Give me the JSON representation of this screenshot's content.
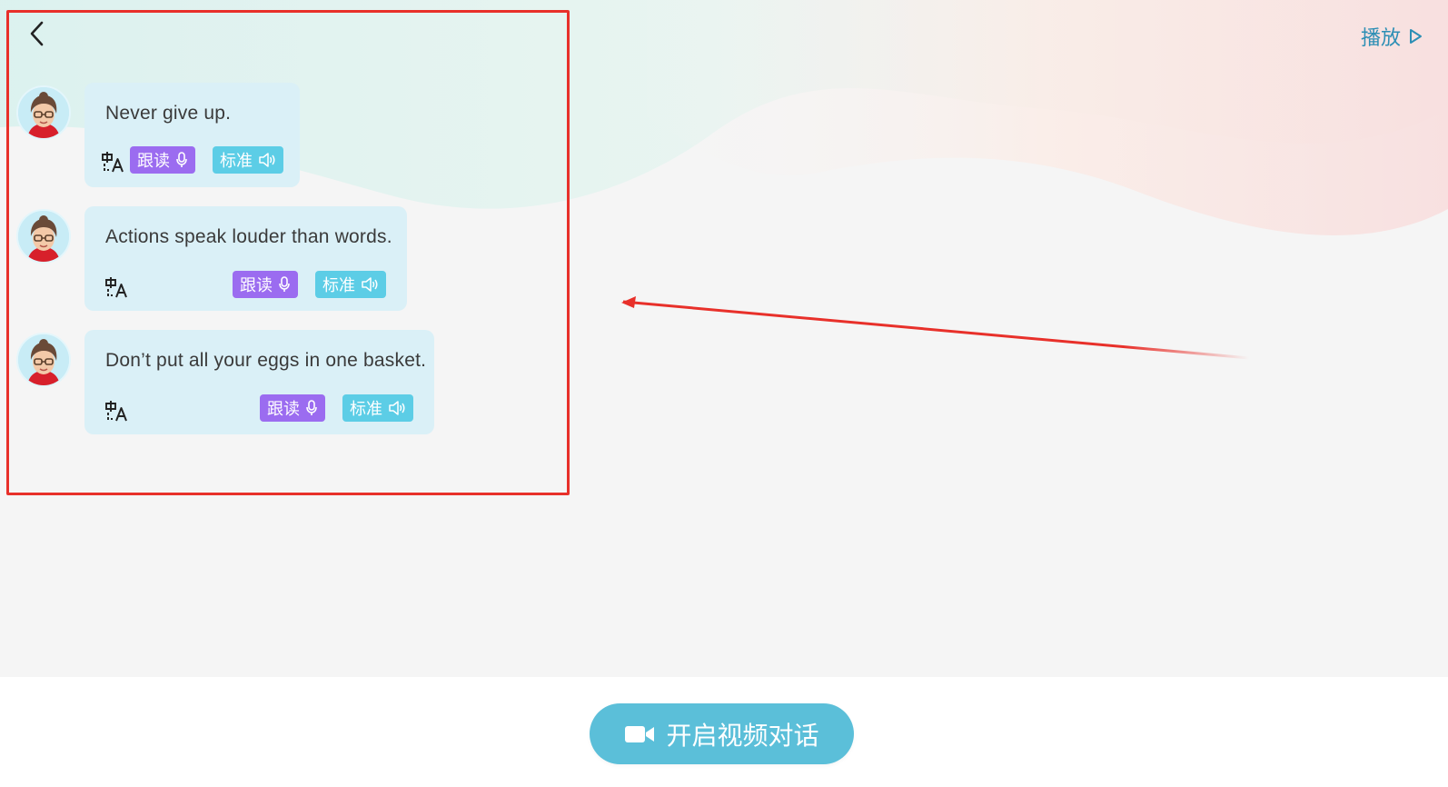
{
  "header": {
    "back_icon": "chevron-left-icon",
    "play_label": "播放",
    "play_icon": "play-triangle-icon"
  },
  "messages": [
    {
      "text": "Never give up.",
      "follow_label": "跟读",
      "standard_label": "标准"
    },
    {
      "text": "Actions speak louder than words.",
      "follow_label": "跟读",
      "standard_label": "标准"
    },
    {
      "text": "Don’t put all your eggs in one basket.",
      "follow_label": "跟读",
      "standard_label": "标准"
    }
  ],
  "footer": {
    "video_button_label": "开启视频对话",
    "video_icon": "video-camera-icon"
  },
  "colors": {
    "accent_teal": "#5bbfd9",
    "follow_purple": "#9b6cf0",
    "standard_cyan": "#5ccde6",
    "bubble_bg": "#daf0f7",
    "annotation_red": "#e8302a"
  }
}
